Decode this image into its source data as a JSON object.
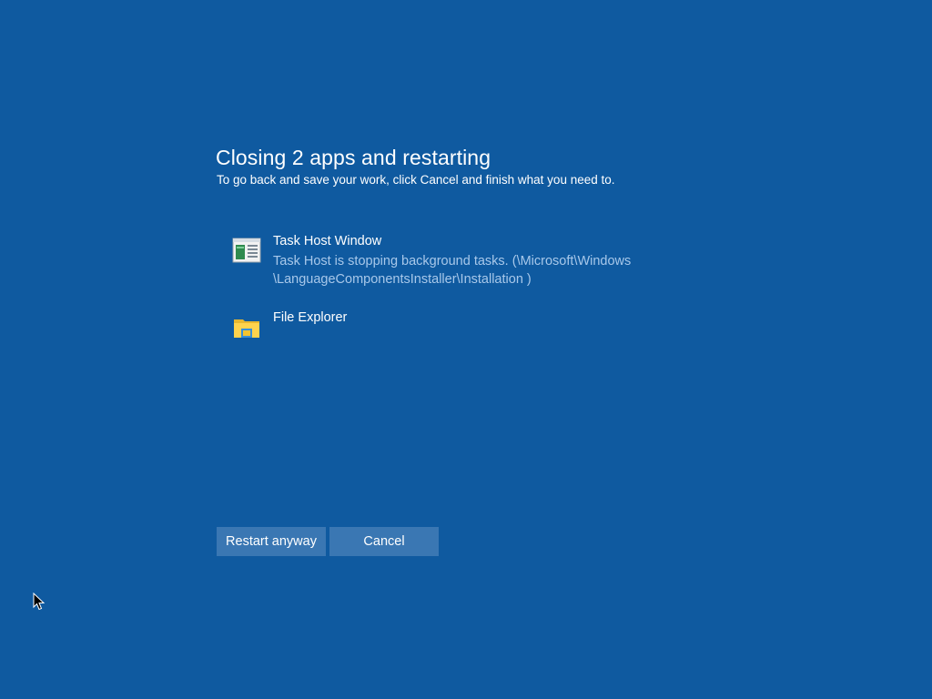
{
  "dialog": {
    "title": "Closing 2 apps and restarting",
    "subtitle": "To go back and save your work, click Cancel and finish what you need to."
  },
  "apps": [
    {
      "name": "Task Host Window",
      "description_line1": "Task Host is stopping background tasks. (\\Microsoft\\Windows",
      "description_line2": "\\LanguageComponentsInstaller\\Installation )",
      "icon": "task-host-icon"
    },
    {
      "name": "File Explorer",
      "icon": "file-explorer-icon"
    }
  ],
  "buttons": {
    "restart_label": "Restart anyway",
    "cancel_label": "Cancel"
  },
  "colors": {
    "background": "#0f5aa0",
    "button": "#3a77b3",
    "description_text": "#a8c8ea"
  }
}
